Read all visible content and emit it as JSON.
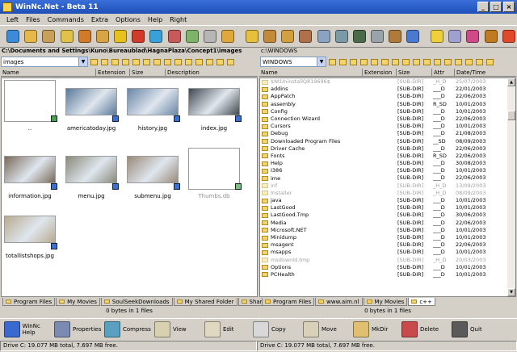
{
  "window": {
    "title": "WinNc.Net - Beta 11"
  },
  "menu": [
    "Left",
    "Files",
    "Commands",
    "Extra",
    "Options",
    "Help",
    "Right"
  ],
  "toolbar": {
    "icons": [
      {
        "name": "tool-icon",
        "color": "#3b8bd6"
      },
      {
        "name": "notes-icon",
        "color": "#e6b84a"
      },
      {
        "name": "archive-icon",
        "color": "#c9a05a"
      },
      {
        "name": "database-icon",
        "color": "#e0c24a"
      },
      {
        "name": "zip-icon",
        "color": "#d07a2a"
      },
      {
        "name": "unzip-icon",
        "color": "#d8a445"
      },
      {
        "name": "mark-icon",
        "color": "#e8c21c"
      },
      {
        "name": "pin-icon",
        "color": "#d23a2a"
      },
      {
        "name": "compare-icon",
        "color": "#3aa0d8"
      },
      {
        "name": "sync-icon",
        "color": "#c95a5a"
      },
      {
        "name": "ftp-icon",
        "color": "#7db46a"
      },
      {
        "name": "computer-icon",
        "color": "#b6b6b6"
      },
      {
        "name": "find-icon",
        "color": "#e0a73a"
      },
      {
        "name": "gift-icon",
        "color": "#e7bf3a"
      },
      {
        "name": "package-icon",
        "color": "#c38a3a"
      },
      {
        "name": "split-icon",
        "color": "#d3a040"
      },
      {
        "name": "books-icon",
        "color": "#b0704a"
      },
      {
        "name": "print-icon",
        "color": "#8aa3c0"
      },
      {
        "name": "search-icon",
        "color": "#7a9aa8"
      },
      {
        "name": "cash-icon",
        "color": "#4a6a4a"
      },
      {
        "name": "disk-icon",
        "color": "#9aa2aa"
      },
      {
        "name": "drive-icon",
        "color": "#b07a3a"
      },
      {
        "name": "network-icon",
        "color": "#4a7ad0"
      },
      {
        "name": "tip-icon",
        "color": "#f0d03a"
      },
      {
        "name": "tools-icon",
        "color": "#a0a0d0"
      },
      {
        "name": "bag-icon",
        "color": "#d04a8a"
      },
      {
        "name": "browse-icon",
        "color": "#c07a20"
      },
      {
        "name": "exit-icon",
        "color": "#e04a2a"
      }
    ]
  },
  "left": {
    "path": "C:\\Documents and Settings\\Kuno\\Bureaublad\\HagnaPlaza\\Concept1\\images",
    "combo": "images",
    "columns": [
      "Name",
      "Extension",
      "Size",
      "Description"
    ],
    "thumbs": [
      {
        "caption": "..",
        "kind": "up"
      },
      {
        "caption": "americatoday.jpg",
        "kind": "photo",
        "color": "#5a7a9a"
      },
      {
        "caption": "history.jpg",
        "kind": "photo",
        "color": "#6a86a8"
      },
      {
        "caption": "index.jpg",
        "kind": "photo",
        "color": "#404850"
      },
      {
        "caption": "information.jpg",
        "kind": "photo",
        "color": "#7a6a5a"
      },
      {
        "caption": "menu.jpg",
        "kind": "photo",
        "color": "#8a8a7a"
      },
      {
        "caption": "submenu.jpg",
        "kind": "photo",
        "color": "#9a8a7a"
      },
      {
        "caption": "Thumbs.db",
        "kind": "db"
      },
      {
        "caption": "totallistshops.jpg",
        "kind": "photo",
        "color": "#b8aa90"
      }
    ],
    "tabs": [
      "Program Files",
      "My Movies",
      "SoulSeekDownloads",
      "My Shared Folder",
      "Shared"
    ],
    "status": "0 bytes in 1 files"
  },
  "right": {
    "path": "c:\\WINDOWS",
    "combo": "WINDOWS",
    "columns": [
      "Name",
      "Extension",
      "Size",
      "Attr",
      "Date/Time"
    ],
    "files": [
      {
        "name": "$NtUninstallQ819696$",
        "size": "[SUB-DIR]",
        "attr": "_H_D",
        "date": "25/07/2003",
        "dim": true
      },
      {
        "name": "addins",
        "size": "[SUB-DIR]",
        "attr": "___D",
        "date": "22/01/2003",
        "dim": false
      },
      {
        "name": "AppPatch",
        "size": "[SUB-DIR]",
        "attr": "___D",
        "date": "22/06/2003",
        "dim": false
      },
      {
        "name": "assembly",
        "size": "[SUB-DIR]",
        "attr": "R_SD",
        "date": "10/01/2003",
        "dim": false
      },
      {
        "name": "Config",
        "size": "[SUB-DIR]",
        "attr": "___D",
        "date": "10/01/2003",
        "dim": false
      },
      {
        "name": "Connection Wizard",
        "size": "[SUB-DIR]",
        "attr": "___D",
        "date": "22/06/2003",
        "dim": false
      },
      {
        "name": "Cursors",
        "size": "[SUB-DIR]",
        "attr": "___D",
        "date": "10/01/2003",
        "dim": false
      },
      {
        "name": "Debug",
        "size": "[SUB-DIR]",
        "attr": "___D",
        "date": "21/08/2003",
        "dim": false
      },
      {
        "name": "Downloaded Program Files",
        "size": "[SUB-DIR]",
        "attr": "__SD",
        "date": "08/09/2003",
        "dim": false
      },
      {
        "name": "Driver Cache",
        "size": "[SUB-DIR]",
        "attr": "___D",
        "date": "22/06/2003",
        "dim": false
      },
      {
        "name": "Fonts",
        "size": "[SUB-DIR]",
        "attr": "R_SD",
        "date": "22/06/2003",
        "dim": false
      },
      {
        "name": "Help",
        "size": "[SUB-DIR]",
        "attr": "___D",
        "date": "30/08/2003",
        "dim": false
      },
      {
        "name": "I386",
        "size": "[SUB-DIR]",
        "attr": "___D",
        "date": "10/01/2003",
        "dim": false
      },
      {
        "name": "ime",
        "size": "[SUB-DIR]",
        "attr": "___D",
        "date": "22/06/2003",
        "dim": false
      },
      {
        "name": "inf",
        "size": "[SUB-DIR]",
        "attr": "_H_D",
        "date": "13/09/2003",
        "dim": true
      },
      {
        "name": "Installer",
        "size": "[SUB-DIR]",
        "attr": "_H_D",
        "date": "08/09/2003",
        "dim": true
      },
      {
        "name": "java",
        "size": "[SUB-DIR]",
        "attr": "___D",
        "date": "10/01/2003",
        "dim": false
      },
      {
        "name": "LastGood",
        "size": "[SUB-DIR]",
        "attr": "___D",
        "date": "10/01/2003",
        "dim": false
      },
      {
        "name": "LastGood.Tmp",
        "size": "[SUB-DIR]",
        "attr": "___D",
        "date": "30/06/2003",
        "dim": false
      },
      {
        "name": "Media",
        "size": "[SUB-DIR]",
        "attr": "___D",
        "date": "22/06/2003",
        "dim": false
      },
      {
        "name": "Microsoft.NET",
        "size": "[SUB-DIR]",
        "attr": "___D",
        "date": "10/01/2003",
        "dim": false
      },
      {
        "name": "Minidump",
        "size": "[SUB-DIR]",
        "attr": "___D",
        "date": "10/01/2003",
        "dim": false
      },
      {
        "name": "msagent",
        "size": "[SUB-DIR]",
        "attr": "___D",
        "date": "22/06/2003",
        "dim": false
      },
      {
        "name": "msapps",
        "size": "[SUB-DIR]",
        "attr": "___D",
        "date": "10/01/2003",
        "dim": false
      },
      {
        "name": "msdownld.tmp",
        "size": "[SUB-DIR]",
        "attr": "_H_D",
        "date": "20/03/2003",
        "dim": true
      },
      {
        "name": "Options",
        "size": "[SUB-DIR]",
        "attr": "___D",
        "date": "10/01/2003",
        "dim": false
      },
      {
        "name": "PCHealth",
        "size": "[SUB-DIR]",
        "attr": "___D",
        "date": "10/01/2003",
        "dim": false
      }
    ],
    "tabs": [
      "Program Files",
      "www.aim.nl",
      "My Movies",
      "c++"
    ],
    "status": "0 bytes in 1 files"
  },
  "functionbar": [
    {
      "label": "WinNc Help",
      "icon": "help-icon",
      "color": "#3a6ad0"
    },
    {
      "label": "Properties",
      "icon": "properties-icon",
      "color": "#7a8ab0"
    },
    {
      "label": "Compress",
      "icon": "compress-icon",
      "color": "#5aa0c0"
    },
    {
      "label": "View",
      "icon": "view-icon",
      "color": "#d8d0b0"
    },
    {
      "label": "Edit",
      "icon": "edit-icon",
      "color": "#e0d8c0"
    },
    {
      "label": "Copy",
      "icon": "copy-icon",
      "color": "#d8d8d8"
    },
    {
      "label": "Move",
      "icon": "move-icon",
      "color": "#d8d0b8"
    },
    {
      "label": "MkDir",
      "icon": "mkdir-icon",
      "color": "#e0c070"
    },
    {
      "label": "Delete",
      "icon": "delete-icon",
      "color": "#c84a4a"
    },
    {
      "label": "Quit",
      "icon": "quit-icon",
      "color": "#5a5a5a"
    }
  ],
  "bottom": {
    "left": "Drive C: 19.077 MB total, 7.697 MB free.",
    "right": "Drive C: 19.077 MB total, 7.697 MB free."
  }
}
